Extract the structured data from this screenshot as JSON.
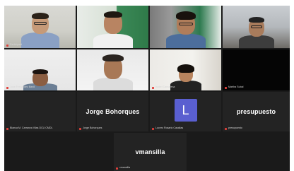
{
  "tiles": [
    {
      "name": "Participant",
      "kind": "video"
    },
    {
      "name": "",
      "kind": "video"
    },
    {
      "name": "",
      "kind": "video"
    },
    {
      "name": "",
      "kind": "video"
    },
    {
      "name": "Jose Fernandez Bardi",
      "kind": "video"
    },
    {
      "name": "",
      "kind": "video"
    },
    {
      "name": "Isabel Camarena",
      "kind": "video"
    },
    {
      "name": "Martha Subal",
      "kind": "video"
    },
    {
      "name": "Blanca M. Carranza Vilas DCU CMDL",
      "kind": "off"
    },
    {
      "name": "Jorge Bohorques",
      "display": "Jorge Bohorques",
      "kind": "off"
    },
    {
      "name": "Lucero Rosario Casallas",
      "avatar": "L",
      "kind": "avatar"
    },
    {
      "name": "presupuesto",
      "display": "presupuesto",
      "kind": "off"
    },
    {
      "name": "vmansilla",
      "display": "vmansilla",
      "kind": "off"
    }
  ],
  "colors": {
    "active_border": "#d6e84a",
    "avatar_bg": "#5a5fd0",
    "muted_mic": "#e0403a"
  }
}
